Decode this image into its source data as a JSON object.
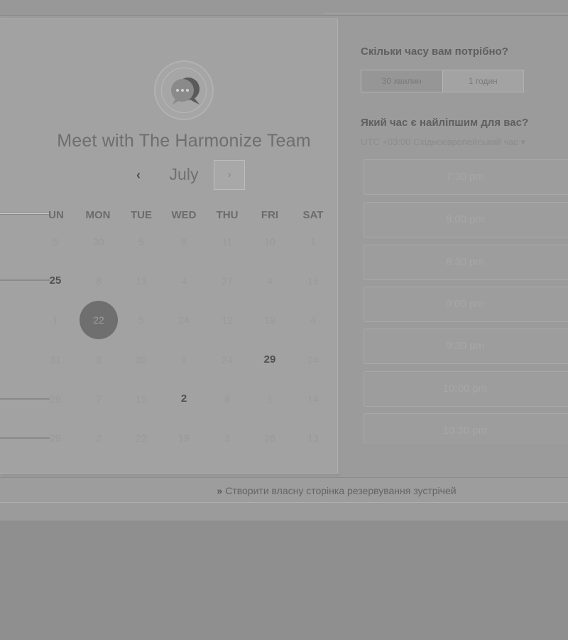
{
  "calendar": {
    "title": "Meet with The Harmonize Team",
    "month": "July",
    "prev_glyph": "‹",
    "next_glyph": "›",
    "weekdays": [
      "UN",
      "MON",
      "TUE",
      "WED",
      "THU",
      "FRI",
      "SAT"
    ],
    "weeks": [
      [
        "5",
        "30",
        "5",
        "8",
        "11",
        "10",
        "1"
      ],
      [
        "25",
        "8",
        "13",
        "4",
        "27",
        "4",
        "15"
      ],
      [
        "1",
        "22",
        "5",
        "24",
        "12",
        "19",
        "4"
      ],
      [
        "31",
        "3",
        "30",
        "9",
        "24",
        "29",
        "24"
      ],
      [
        "29",
        "7",
        "15",
        "2",
        "8",
        "1",
        "14"
      ],
      [
        "29",
        "2",
        "22",
        "19",
        "3",
        "26",
        "13"
      ]
    ],
    "selected_day": "22"
  },
  "booking": {
    "duration_label": "Скільки часу вам потрібно?",
    "duration_options": [
      "30 хвилин",
      "1 годин"
    ],
    "time_label": "Який час є найліпшим для вас?",
    "timezone": "UTC +03:00 Східноєвропейський час ▾",
    "time_slots": [
      "7:30 pm",
      "8:00 pm",
      "8:30 pm",
      "9:00 pm",
      "9:30 pm",
      "10:00 pm",
      "10:30 pm"
    ]
  },
  "footer": {
    "arrow": "»",
    "link": "Створити власну сторінка резервування зустрічей"
  },
  "colors": {
    "background": "#8f8f8f",
    "panel": "#a2a2a2",
    "selected_day": "#6f6f6f"
  }
}
